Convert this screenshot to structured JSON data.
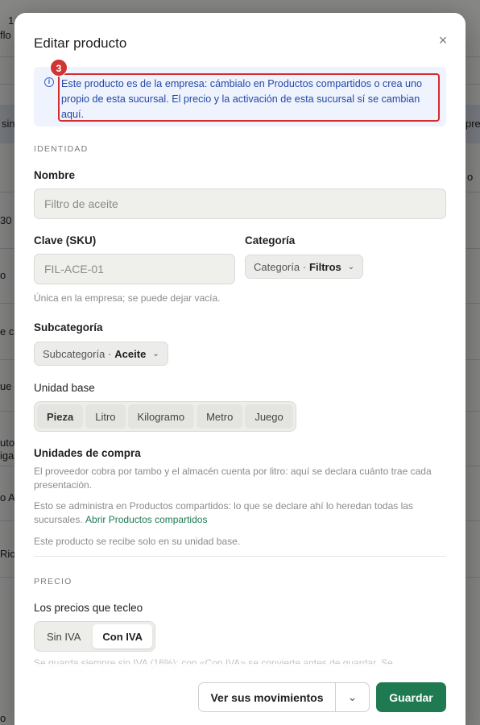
{
  "background": {
    "fragments": [
      "1",
      "flo",
      "sin",
      "pre",
      "30",
      "o",
      "e c",
      "ue",
      "uto",
      "iga",
      "o Av",
      "Rio",
      "o",
      "o"
    ]
  },
  "modal": {
    "title": "Editar producto",
    "close_icon": "×",
    "info": {
      "icon": "i",
      "step_badge": "3",
      "text": "Este producto es de la empresa: cámbialo en Productos compartidos o crea uno propio de esta sucursal. El precio y la activación de esta sucursal sí se cambian aquí."
    },
    "identity": {
      "section_label": "IDENTIDAD",
      "name_label": "Nombre",
      "name_placeholder": "Filtro de aceite",
      "sku_label": "Clave (SKU)",
      "sku_placeholder": "FIL-ACE-01",
      "sku_helper": "Única en la empresa; se puede dejar vacía.",
      "category_label": "Categoría",
      "category_prefix": "Categoría ·",
      "category_value": "Filtros",
      "subcategory_label": "Subcategoría",
      "subcategory_prefix": "Subcategoría ·",
      "subcategory_value": "Aceite",
      "unit_label": "Unidad base",
      "units": [
        "Pieza",
        "Litro",
        "Kilogramo",
        "Metro",
        "Juego"
      ],
      "purchase_units_label": "Unidades de compra",
      "purchase_units_desc": "El proveedor cobra por tambo y el almacén cuenta por litro: aquí se declara cuánto trae cada presentación.",
      "shared_note": "Esto se administra en Productos compartidos: lo que se declare ahí lo heredan todas las sucursales.",
      "shared_link": "Abrir Productos compartidos",
      "base_unit_note": "Este producto se recibe solo en su unidad base."
    },
    "price": {
      "section_label": "PRECIO",
      "mode_label": "Los precios que tecleo",
      "mode_options": [
        "Sin IVA",
        "Con IVA"
      ],
      "selected_mode": "Con IVA",
      "faded_note": "Se guarda siempre sin IVA (16%); con «Con IVA» se convierte antes de guardar. Se"
    },
    "footer": {
      "movements_button": "Ver sus movimientos",
      "save_button": "Guardar"
    }
  }
}
